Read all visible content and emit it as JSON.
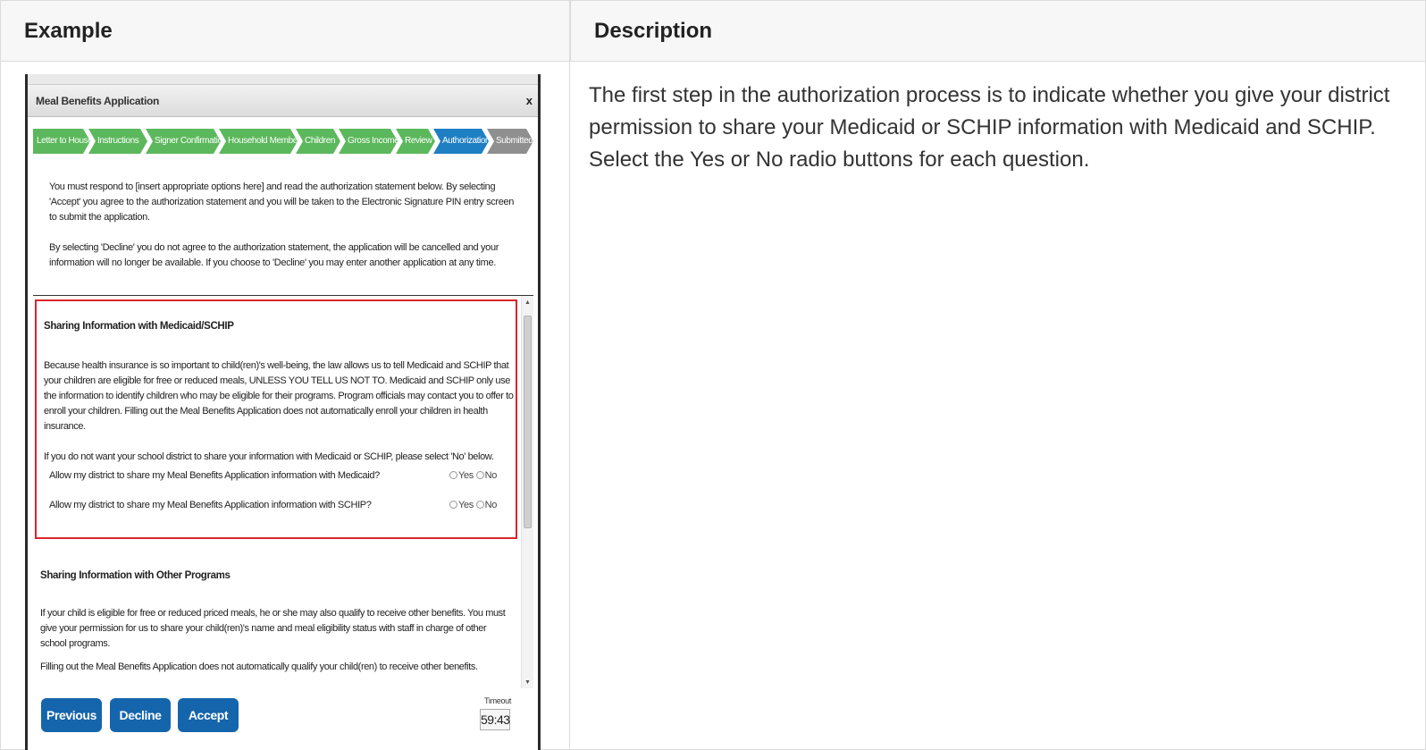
{
  "table": {
    "header_example": "Example",
    "header_description": "Description",
    "description": "The first step in the authorization process is to indicate whether you give your district permission to share your Medicaid or SCHIP information with Medicaid and SCHIP. Select the Yes or No radio buttons for each question."
  },
  "dialog": {
    "title": "Meal Benefits Application",
    "close": "x",
    "steps": [
      {
        "label": "Letter to Household",
        "state": "done"
      },
      {
        "label": "Instructions",
        "state": "done"
      },
      {
        "label": "Signer Confirmation",
        "state": "done"
      },
      {
        "label": "Household Members",
        "state": "done"
      },
      {
        "label": "Children",
        "state": "done"
      },
      {
        "label": "Gross Income",
        "state": "done"
      },
      {
        "label": "Review",
        "state": "done"
      },
      {
        "label": "Authorization",
        "state": "current"
      },
      {
        "label": "Submitted",
        "state": "next"
      }
    ],
    "intro_1": "You must respond to [insert appropriate options here] and read the authorization statement below. By selecting 'Accept' you agree to the authorization statement and you will be taken to the Electronic Signature PIN entry screen to submit the application.",
    "intro_2": "By selecting 'Decline' you do not agree to the authorization statement, the application will be cancelled and your information will no longer be available. If you choose to 'Decline' you may enter another application at any time.",
    "medicaid": {
      "title": "Sharing Information with Medicaid/SCHIP",
      "para": "Because health insurance is so important to child(ren)'s well-being, the law allows us to tell Medicaid and SCHIP that your children are eligible for free or reduced meals, UNLESS YOU TELL US NOT TO.  Medicaid and SCHIP only use the information to identify children who may be eligible for their programs. Program officials may contact you to offer to enroll your children. Filling out the Meal Benefits Application does not automatically enroll your children in health insurance.",
      "instruction": "If you do not want your school district to share your information with Medicaid or SCHIP, please select 'No' below.",
      "q1": "Allow my district to share my Meal Benefits Application information with Medicaid?",
      "q2": "Allow my district to share my Meal Benefits Application information with SCHIP?",
      "yes": "Yes",
      "no": "No"
    },
    "other": {
      "title": "Sharing Information with Other Programs",
      "para1": "If your child is eligible for free or reduced priced meals, he or she may also qualify to receive other benefits. You must give your permission for us to share your child(ren)'s name and meal eligibility status with staff in charge of other school programs.",
      "para2": "Filling out the Meal Benefits Application does not automatically qualify your child(ren) to receive other benefits."
    },
    "buttons": {
      "previous": "Previous",
      "decline": "Decline",
      "accept": "Accept"
    },
    "timeout_label": "Timeout",
    "timeout_value": "59:43"
  }
}
